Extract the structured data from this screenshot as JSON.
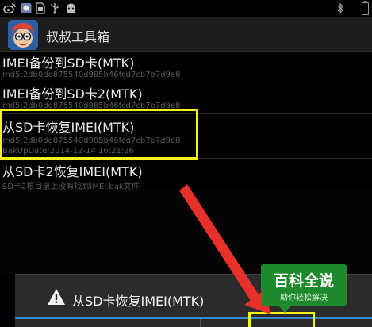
{
  "status_bar": {
    "icons": [
      "weibo-icon",
      "app-notification-icon",
      "sim-icon",
      "usb-icon",
      "android-icon"
    ],
    "right_icons": [
      "bluetooth-icon",
      "battery-icon"
    ]
  },
  "action_bar": {
    "title": "叔叔工具箱"
  },
  "list": {
    "items": [
      {
        "title": "IMEI备份到SD卡(MTK)",
        "sub1": "md5:2db0dd875540d985b46fcd7cb7b7d9e8",
        "sub2": ""
      },
      {
        "title": "IMEI备份到SD卡2(MTK)",
        "sub1": "md5:2db0dd875540d985b46fcd7cb7b7d9e8",
        "sub2": ""
      },
      {
        "title": "从SD卡恢复IMEI(MTK)",
        "sub1": "md5:2db0dd875540d985b46fcd7cb7b7d9e8",
        "sub2": "BakUpDate:2014-12-14 16:21:26"
      },
      {
        "title": "从SD卡2恢复IMEI(MTK)",
        "sub1": "SD卡2根目录上没有找到IMEI.bak文件",
        "sub2": ""
      }
    ]
  },
  "dialog": {
    "title": "从SD卡恢复IMEI(MTK)",
    "icon": "warning-icon"
  },
  "watermark": {
    "line1": "百科全说",
    "line2": "助你轻松解决"
  },
  "colors": {
    "highlight": "#f4f41a",
    "arrow": "#e8302a",
    "dialog_accent": "#3a87c7",
    "watermark_bg": "#1f8a2d"
  }
}
